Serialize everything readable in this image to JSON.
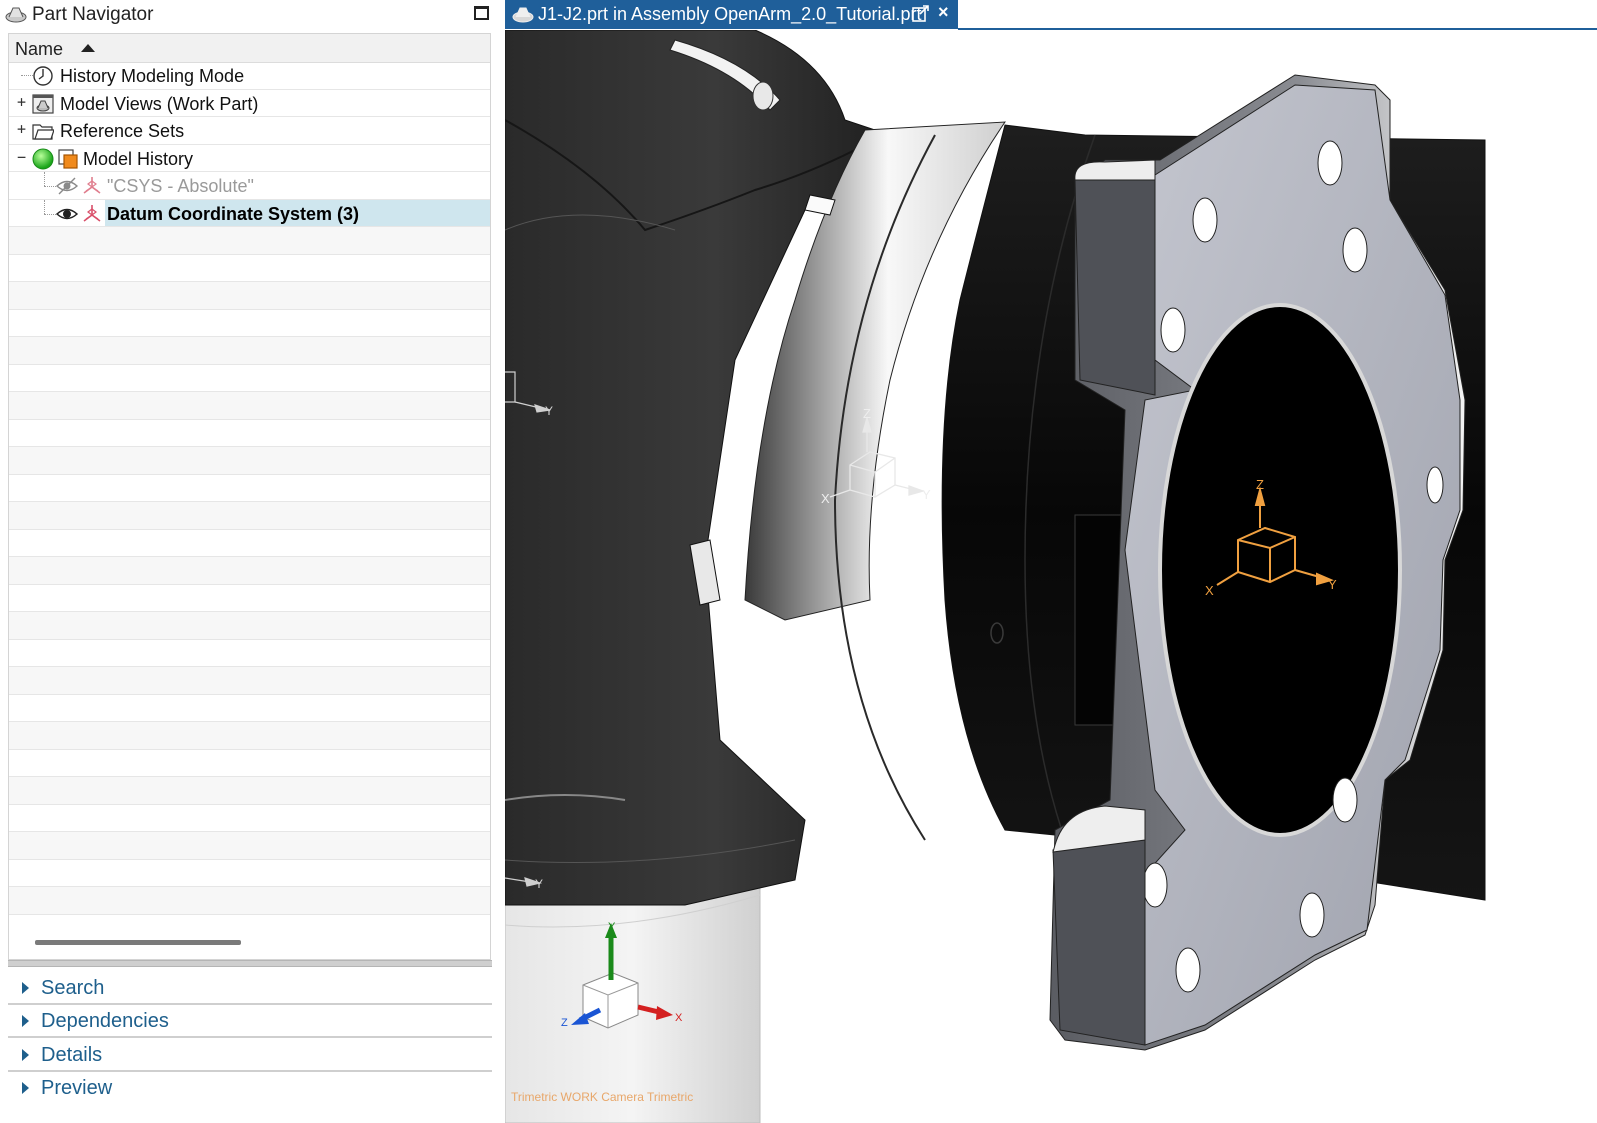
{
  "navigator": {
    "title": "Part Navigator",
    "column_header": "Name",
    "sort": "ascending",
    "items": [
      {
        "label": "History Modeling Mode",
        "icon": "clock-icon",
        "expander": ""
      },
      {
        "label": "Model Views (Work Part)",
        "icon": "model-views-icon",
        "expander": "+"
      },
      {
        "label": "Reference Sets",
        "icon": "folder-icon",
        "expander": "+"
      },
      {
        "label": "Model History",
        "icon": "model-history-icon",
        "expander": "−"
      },
      {
        "label": "\"CSYS - Absolute\"",
        "icon": "csys-icon",
        "visibility": "hidden-eye-icon"
      },
      {
        "label": "Datum Coordinate System (3)",
        "icon": "csys-icon",
        "visibility": "eye-icon",
        "selected": true
      }
    ],
    "sections": [
      {
        "label": "Search"
      },
      {
        "label": "Dependencies"
      },
      {
        "label": "Details"
      },
      {
        "label": "Preview"
      }
    ]
  },
  "graphics": {
    "tab_title": "J1-J2.prt in Assembly OpenArm_2.0_Tutorial.prt",
    "close_glyph": "×",
    "camera_label": "Trimetric WORK Camera Trimetric",
    "triad_labels": {
      "x": "X",
      "y": "Y",
      "z": "Z"
    },
    "colors": {
      "tab": "#1f5f9a",
      "active_csys": "#f0a040",
      "triad_x": "#d42020",
      "triad_y": "#1a8a1a",
      "triad_z": "#1a55d4"
    }
  }
}
